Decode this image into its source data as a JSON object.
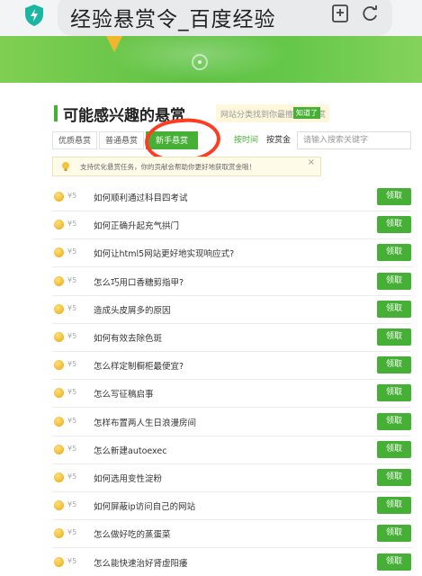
{
  "browser": {
    "url_text": "经验悬赏令_百度经验"
  },
  "section": {
    "title": "可能感兴趣的悬赏",
    "tip_text": "网站分类找到你最擅长的悬赏",
    "tip_button": "知道了"
  },
  "tabs": [
    {
      "label": "优质悬赏",
      "active": false
    },
    {
      "label": "普通悬赏",
      "active": false
    },
    {
      "label": "新手悬赏",
      "active": true
    }
  ],
  "sort": {
    "by_time": "按时间",
    "by_reward": "按赏金"
  },
  "search": {
    "placeholder": "请输入搜索关键字"
  },
  "notice": {
    "text": "支持优化悬赏任务，你的贡献会帮助你更好地获取赏金哦！",
    "close": "×"
  },
  "list": {
    "claim_label": "领取",
    "items": [
      {
        "reward": "¥5",
        "title": "如何顺利通过科目四考试"
      },
      {
        "reward": "¥5",
        "title": "如何正确升起充气拱门"
      },
      {
        "reward": "¥5",
        "title": "如何让html5网站更好地实现响应式?"
      },
      {
        "reward": "¥5",
        "title": "怎么巧用口香糖剪指甲?"
      },
      {
        "reward": "¥5",
        "title": "造成头皮屑多的原因"
      },
      {
        "reward": "¥5",
        "title": "如何有效去除色斑"
      },
      {
        "reward": "¥5",
        "title": "怎么样定制橱柜最便宜?"
      },
      {
        "reward": "¥5",
        "title": "怎么写征稿启事"
      },
      {
        "reward": "¥5",
        "title": "怎样布置两人生日浪漫房间"
      },
      {
        "reward": "¥5",
        "title": "怎么新建autoexec"
      },
      {
        "reward": "¥5",
        "title": "如何选用变性淀粉"
      },
      {
        "reward": "¥5",
        "title": "如何屏蔽ip访问自己的网站"
      },
      {
        "reward": "¥5",
        "title": "怎么做好吃的蒸蛋菜"
      },
      {
        "reward": "¥5",
        "title": "怎么能快速治好肾虚阳痿"
      }
    ]
  },
  "colors": {
    "accent_green": "#45b035",
    "annotation_red": "#ff3c20",
    "coin_gold": "#f0b62c"
  }
}
